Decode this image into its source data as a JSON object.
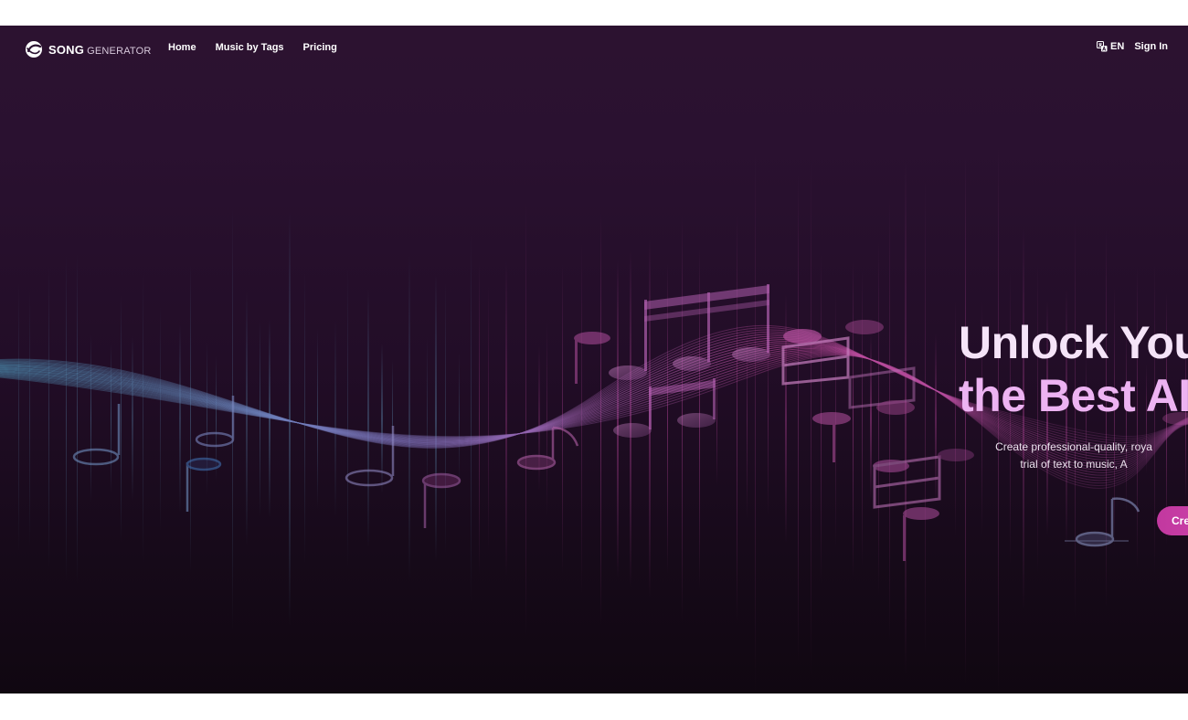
{
  "header": {
    "logo": {
      "word_1": "SONG",
      "word_2": "GENERATOR"
    },
    "nav": [
      {
        "label": "Home"
      },
      {
        "label": "Music by Tags"
      },
      {
        "label": "Pricing"
      }
    ],
    "language": {
      "icon": "translate-icon",
      "label": "EN"
    },
    "sign_in_label": "Sign In"
  },
  "hero": {
    "title_line_1": "Unlock You",
    "title_line_2": "the Best AI",
    "subtitle_line_1": "Create professional-quality, roya",
    "subtitle_line_2": "trial of text to music, A",
    "cta_label": "Cre"
  },
  "colors": {
    "background_top": "#2c1230",
    "background_bottom": "#100711",
    "title_primary": "#f5e4f8",
    "title_accent": "#edb3f2",
    "cta": "#c2389f"
  },
  "icons": {
    "logo": "music-disc-icon",
    "language": "translate-icon",
    "decoration": "music-note-icon"
  }
}
